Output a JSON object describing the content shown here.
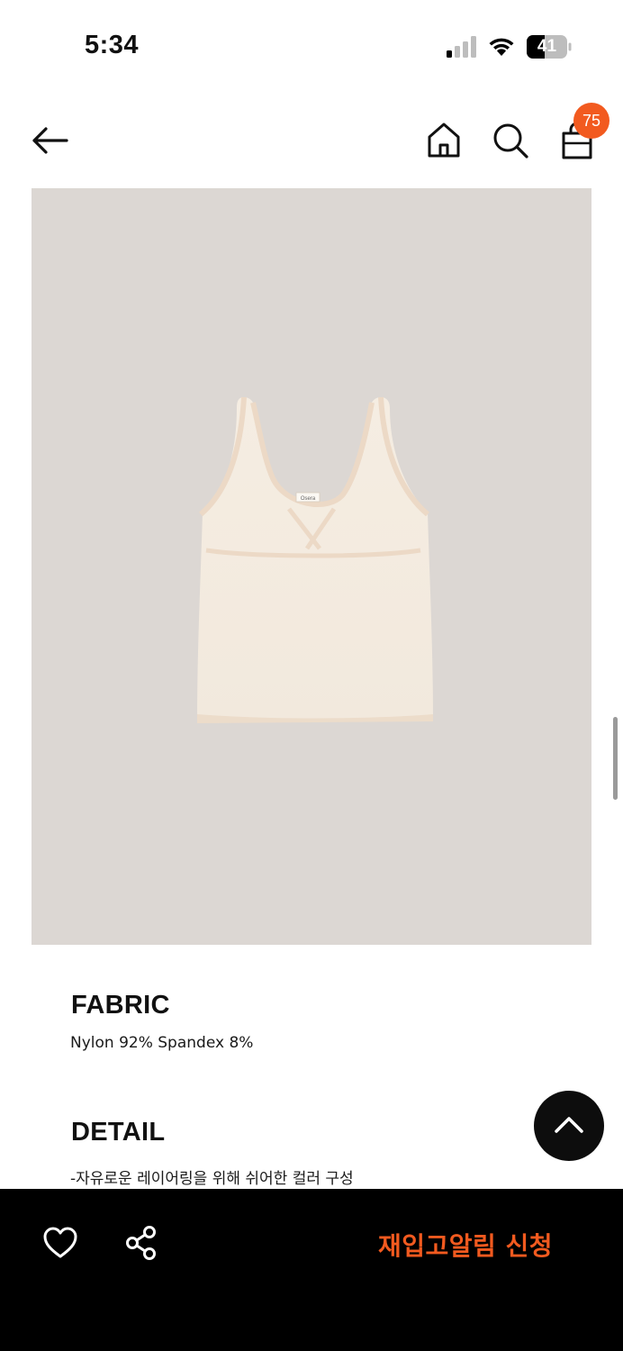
{
  "status_bar": {
    "time": "5:34",
    "battery": "41",
    "icons": [
      "cellular-signal-icon",
      "wifi-icon",
      "battery-icon"
    ]
  },
  "header": {
    "icons": [
      "back-arrow-icon",
      "home-icon",
      "search-icon",
      "shopping-bag-icon"
    ],
    "cart_count": "75"
  },
  "product": {
    "image_label": "Osera"
  },
  "fabric": {
    "title": "FABRIC",
    "text": "Nylon 92% Spandex 8%"
  },
  "detail": {
    "title": "DETAIL",
    "text": "-자유로운 레이어링을 위해 쉬어한 컬러 구성"
  },
  "bottom_bar": {
    "icons": [
      "heart-icon",
      "share-icon"
    ],
    "restock_label": "재입고알림 신청"
  },
  "colors": {
    "accent": "#f25a1f",
    "image_bg": "#dcd7d3",
    "bottom_bar_bg": "#000000"
  }
}
